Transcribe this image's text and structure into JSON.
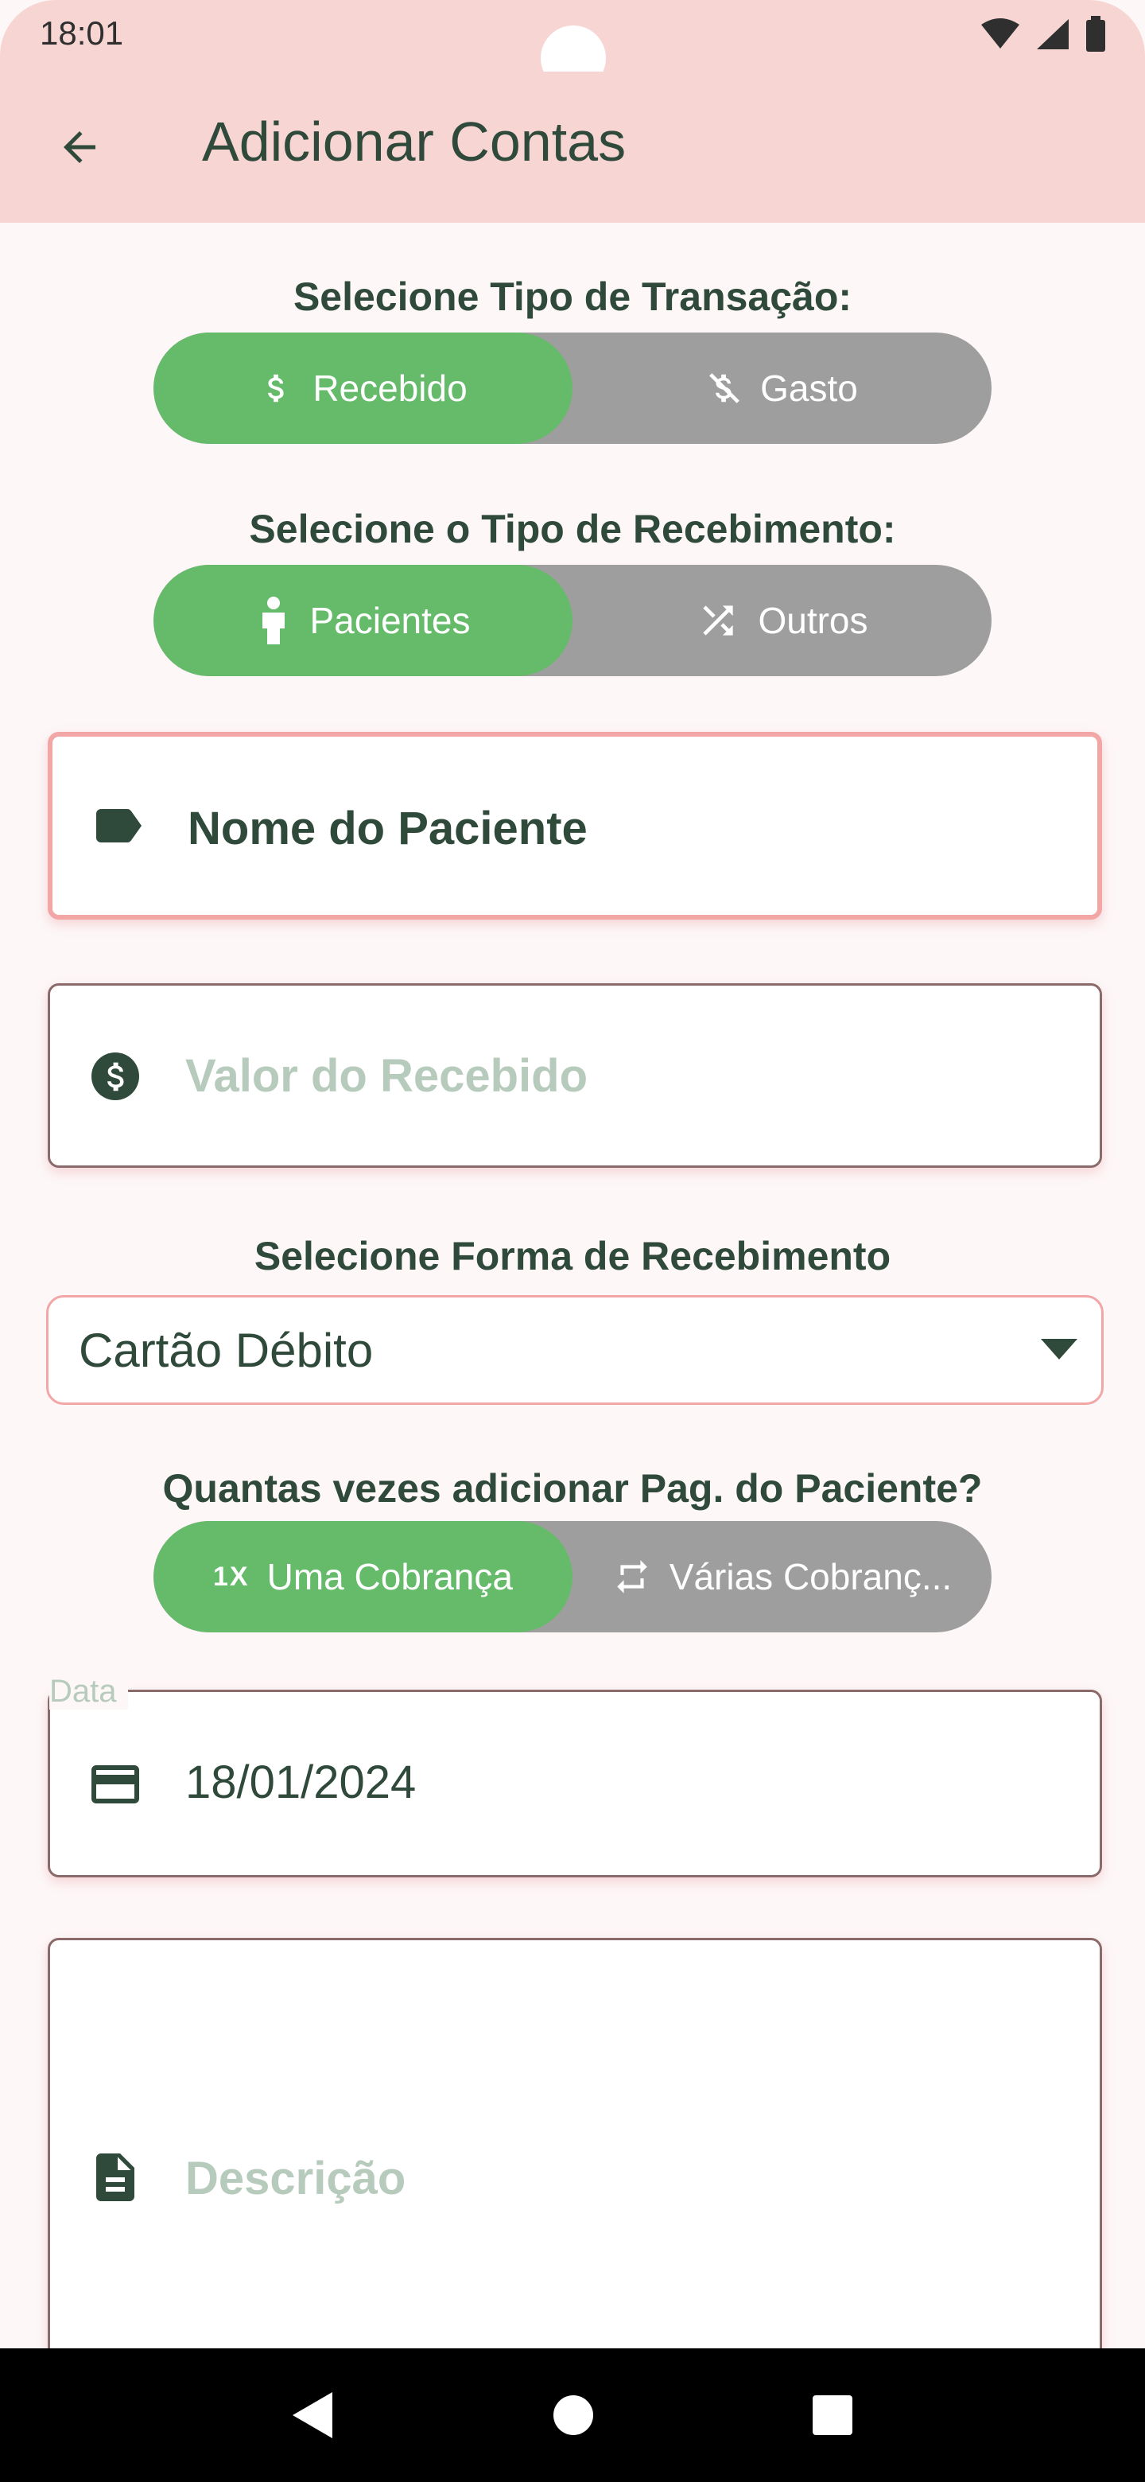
{
  "status_bar": {
    "time": "18:01"
  },
  "app_bar": {
    "title": "Adicionar Contas"
  },
  "transaction_type": {
    "label": "Selecione Tipo de Transação:",
    "options": [
      {
        "label": "Recebido",
        "icon": "dollar-icon",
        "selected": true
      },
      {
        "label": "Gasto",
        "icon": "dollar-off-icon",
        "selected": false
      }
    ]
  },
  "receipt_type": {
    "label": "Selecione o Tipo de Recebimento:",
    "options": [
      {
        "label": "Pacientes",
        "icon": "person-icon",
        "selected": true
      },
      {
        "label": "Outros",
        "icon": "shuffle-icon",
        "selected": false
      }
    ]
  },
  "patient_field": {
    "label": "Nome do Paciente",
    "icon": "label-tag-icon"
  },
  "amount_field": {
    "placeholder": "Valor do Recebido",
    "icon": "dollar-circle-icon"
  },
  "payment_method": {
    "label": "Selecione Forma de Recebimento",
    "selected": "Cartão Débito"
  },
  "repeat": {
    "label": "Quantas vezes adicionar Pag. do Paciente?",
    "options": [
      {
        "label": "Uma Cobrança",
        "icon": "one-x-icon",
        "badge": "1X",
        "selected": true
      },
      {
        "label": "Várias Cobranç...",
        "icon": "repeat-icon",
        "selected": false
      }
    ]
  },
  "date_field": {
    "label": "Data",
    "value": "18/01/2024",
    "icon": "credit-card-icon"
  },
  "description_field": {
    "placeholder": "Descrição",
    "icon": "document-icon"
  },
  "colors": {
    "app_bar": "#f7d5d2",
    "selected": "#66bb6a",
    "unselected": "#9e9e9e",
    "text": "#2f4a3a",
    "accent_border": "#f2a6a6"
  }
}
